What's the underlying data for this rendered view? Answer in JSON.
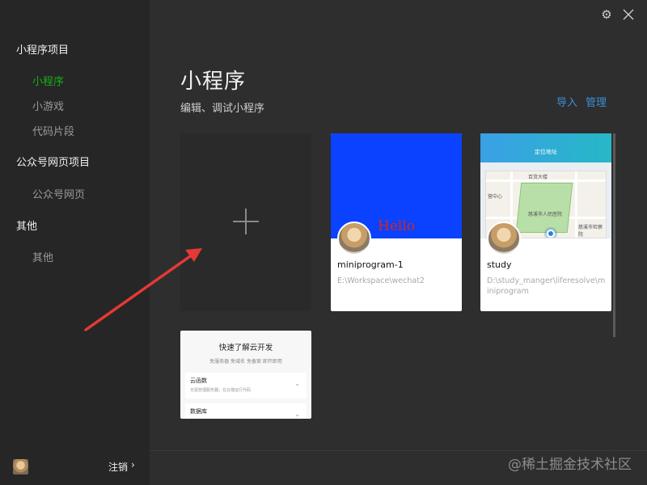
{
  "sidebar": {
    "groups": [
      {
        "title": "小程序项目",
        "items": [
          "小程序",
          "小游戏",
          "代码片段"
        ]
      },
      {
        "title": "公众号网页项目",
        "items": [
          "公众号网页"
        ]
      },
      {
        "title": "其他",
        "items": [
          "其他"
        ]
      }
    ],
    "active_item": "小程序",
    "footer": {
      "logout_label": "注销",
      "chevron": "›"
    }
  },
  "header": {
    "title": "小程序",
    "subtitle": "编辑、调试小程序",
    "import_label": "导入",
    "manage_label": "管理",
    "gear_icon": "⚙",
    "close_icon": "close-icon"
  },
  "projects": [
    {
      "name": "miniprogram-1",
      "path": "E:\\Workspace\\wechat2",
      "thumbnail_text": "Hello",
      "thumbnail_color": "#0a42ff"
    },
    {
      "name": "study",
      "path": "D:\\study_manger\\liferesolve\\miniprogram",
      "thumbnail_text": ""
    }
  ],
  "map_preview": {
    "header_text": "定位地址",
    "labels": [
      "百货大楼",
      "营中心",
      "慈溪市人民医院",
      "慈溪市检察院"
    ]
  },
  "cloud_card": {
    "title": "快速了解云开发",
    "subtitle": "免服务器 免域名 免备案 即开即用",
    "rows": [
      {
        "name": "云函数",
        "desc": "无需管理服务器，在云端运行代码"
      },
      {
        "name": "数据库",
        "desc": ""
      }
    ]
  },
  "watermark": "@稀土掘金技术社区",
  "colors": {
    "accent_green": "#1aad19",
    "link_blue": "#3a8fd6",
    "sidebar_bg": "#262626",
    "main_bg": "#2e2e2e"
  }
}
